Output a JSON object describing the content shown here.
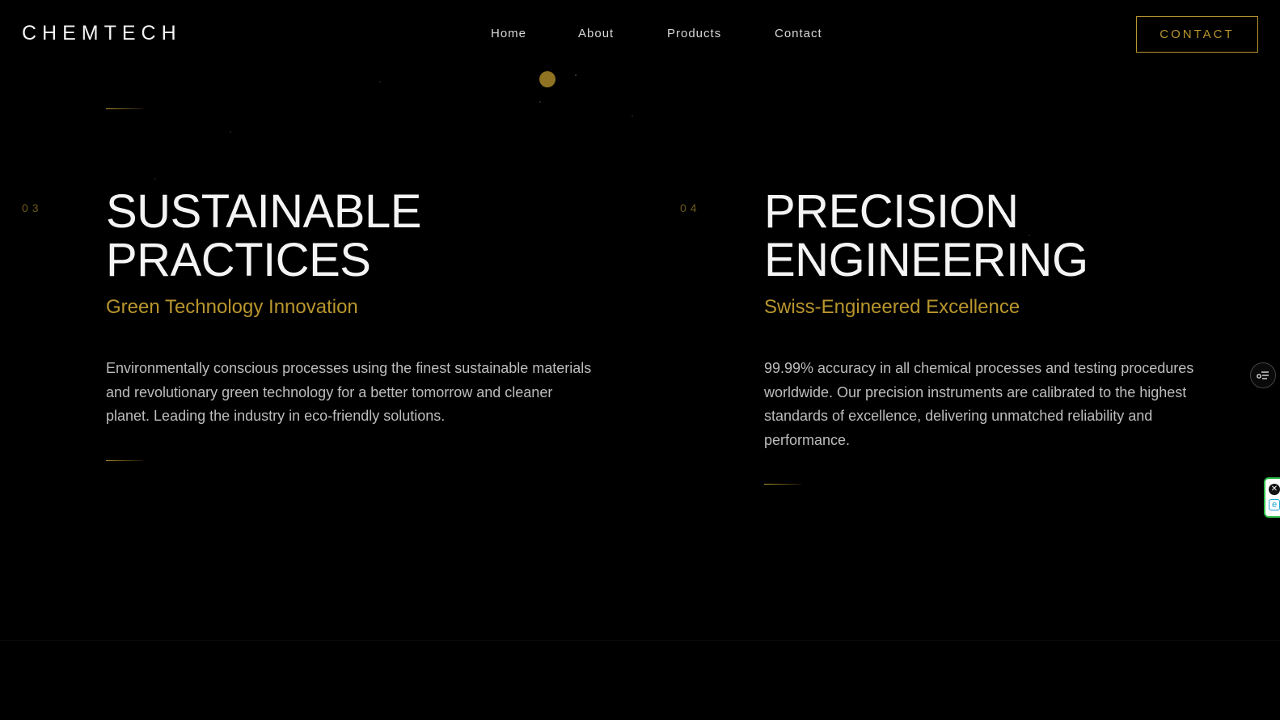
{
  "header": {
    "logo": "CHEMTECH",
    "nav": [
      "Home",
      "About",
      "Products",
      "Contact"
    ],
    "cta_label": "CONTACT"
  },
  "features": [
    {
      "index": "03",
      "title_lines": [
        "SUSTAINABLE",
        "PRACTICES"
      ],
      "subtitle": "Green Technology Innovation",
      "description": "Environmentally conscious processes using the finest sustainable materials and revolutionary green technology for a better tomorrow and cleaner planet. Leading the industry in eco-friendly solutions."
    },
    {
      "index": "04",
      "title_lines": [
        "PRECISION",
        "ENGINEERING"
      ],
      "subtitle": "Swiss-Engineered Excellence",
      "description": "99.99% accuracy in all chemical processes and testing procedures worldwide. Our precision instruments are calibrated to the highest standards of excellence, delivering unmatched reliability and performance."
    }
  ],
  "widgets": {
    "side_tool_icon": "filter-list-icon",
    "extension_close_icon": "close-icon",
    "extension_logo_icon": "extension-logo-icon",
    "extension_close_glyph": "✕",
    "extension_logo_glyph": "e"
  },
  "colors": {
    "background": "#000000",
    "accent_gold": "#b8962e",
    "text_primary": "#f4f4f4",
    "text_secondary": "#bdbdbd",
    "index_muted": "#6d5a1c"
  }
}
